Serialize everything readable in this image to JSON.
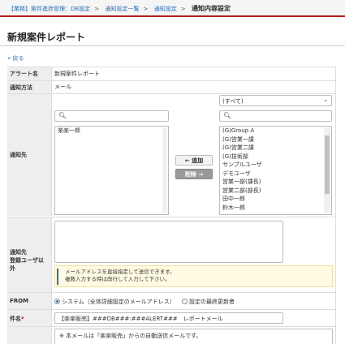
{
  "breadcrumb": {
    "items": [
      "【業務】案件進捗管理：DB設定",
      "通知設定一覧",
      "通知設定"
    ],
    "current": "通知内容設定"
  },
  "page": {
    "title": "新規案件レポート",
    "back": "« 戻る"
  },
  "form": {
    "alert_name_label": "アラート名",
    "alert_name_value": "新規案件レポート",
    "method_label": "通知方法",
    "method_value": "メール",
    "dest_label": "通知先",
    "dropdown_value": "(すべて)",
    "left_list": [
      "楽楽一郎"
    ],
    "right_list": [
      "(G)Group A",
      "(G)営業一課",
      "(G)営業二課",
      "(G)技術部",
      "サンプルユーザ",
      "デモユーザ",
      "営業一部(課長)",
      "営業二部(部長)",
      "田中一郎",
      "鈴木一郎"
    ],
    "add_button": "← 追加",
    "remove_button": "削除 →",
    "other_label_1": "通知先",
    "other_label_2": "登録ユーザ以外",
    "note_line1": "メールアドレスを直接指定して送信できます。",
    "note_line2": "複数入力する時は改行して入力して下さい。",
    "from_label": "FROM",
    "from_option1": "システム（全体詳細設定のメールアドレス）",
    "from_option2": "設定の最終更新者",
    "subject_label": "件名",
    "required_mark": "*",
    "subject_value": "【楽楽販売】###DB###:###ALERT###　レポートメール",
    "body_text": "※ 本メールは「楽楽販売」からの自動送信メールです。"
  },
  "icons": {
    "search": "search-icon",
    "chevron": "chevron-down-icon"
  }
}
